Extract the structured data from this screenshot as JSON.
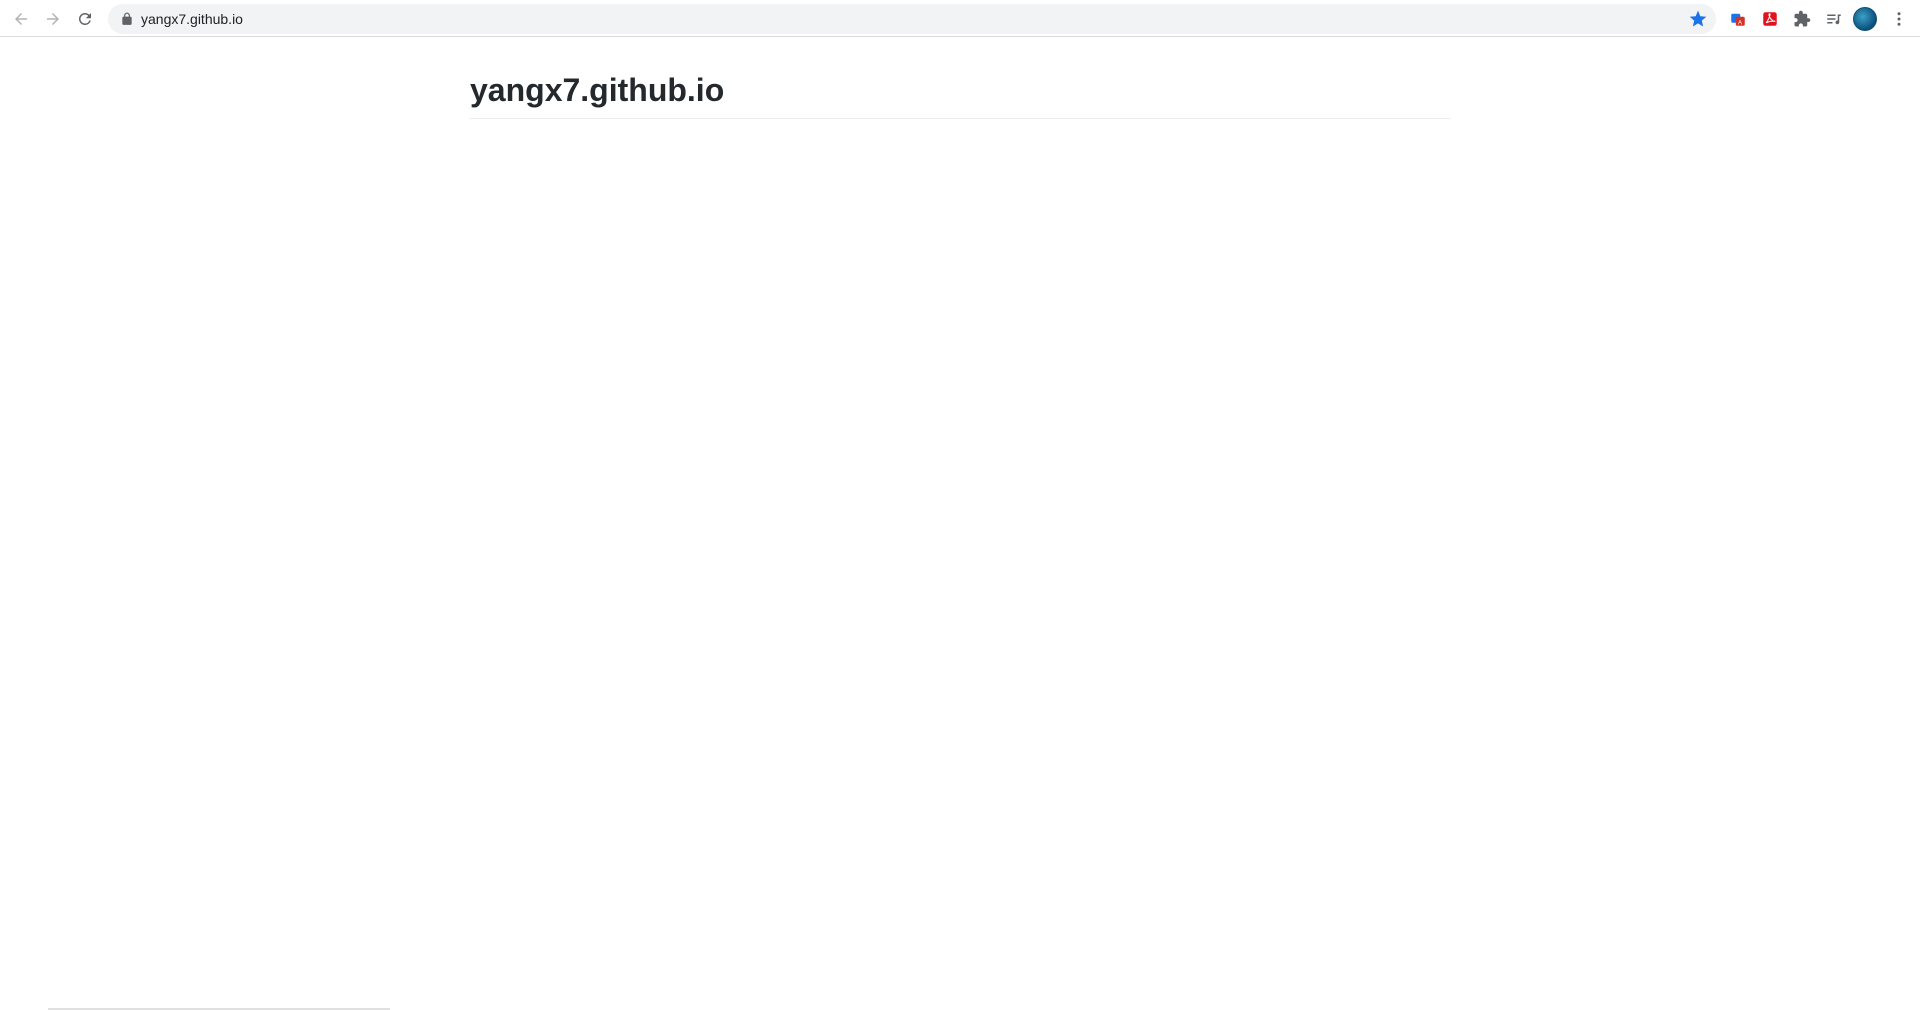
{
  "browser": {
    "url": "yangx7.github.io",
    "bookmark_color": "#1a73e8",
    "icons": {
      "back": "arrow-left-icon",
      "forward": "arrow-right-icon",
      "reload": "reload-icon",
      "lock": "lock-icon",
      "bookmark": "star-icon",
      "extensions": [
        "translate-extension-icon",
        "pdf-extension-icon",
        "puzzle-icon",
        "reading-list-icon"
      ],
      "profile": "profile-avatar",
      "menu": "kebab-menu-icon"
    }
  },
  "page": {
    "title": "yangx7.github.io"
  }
}
